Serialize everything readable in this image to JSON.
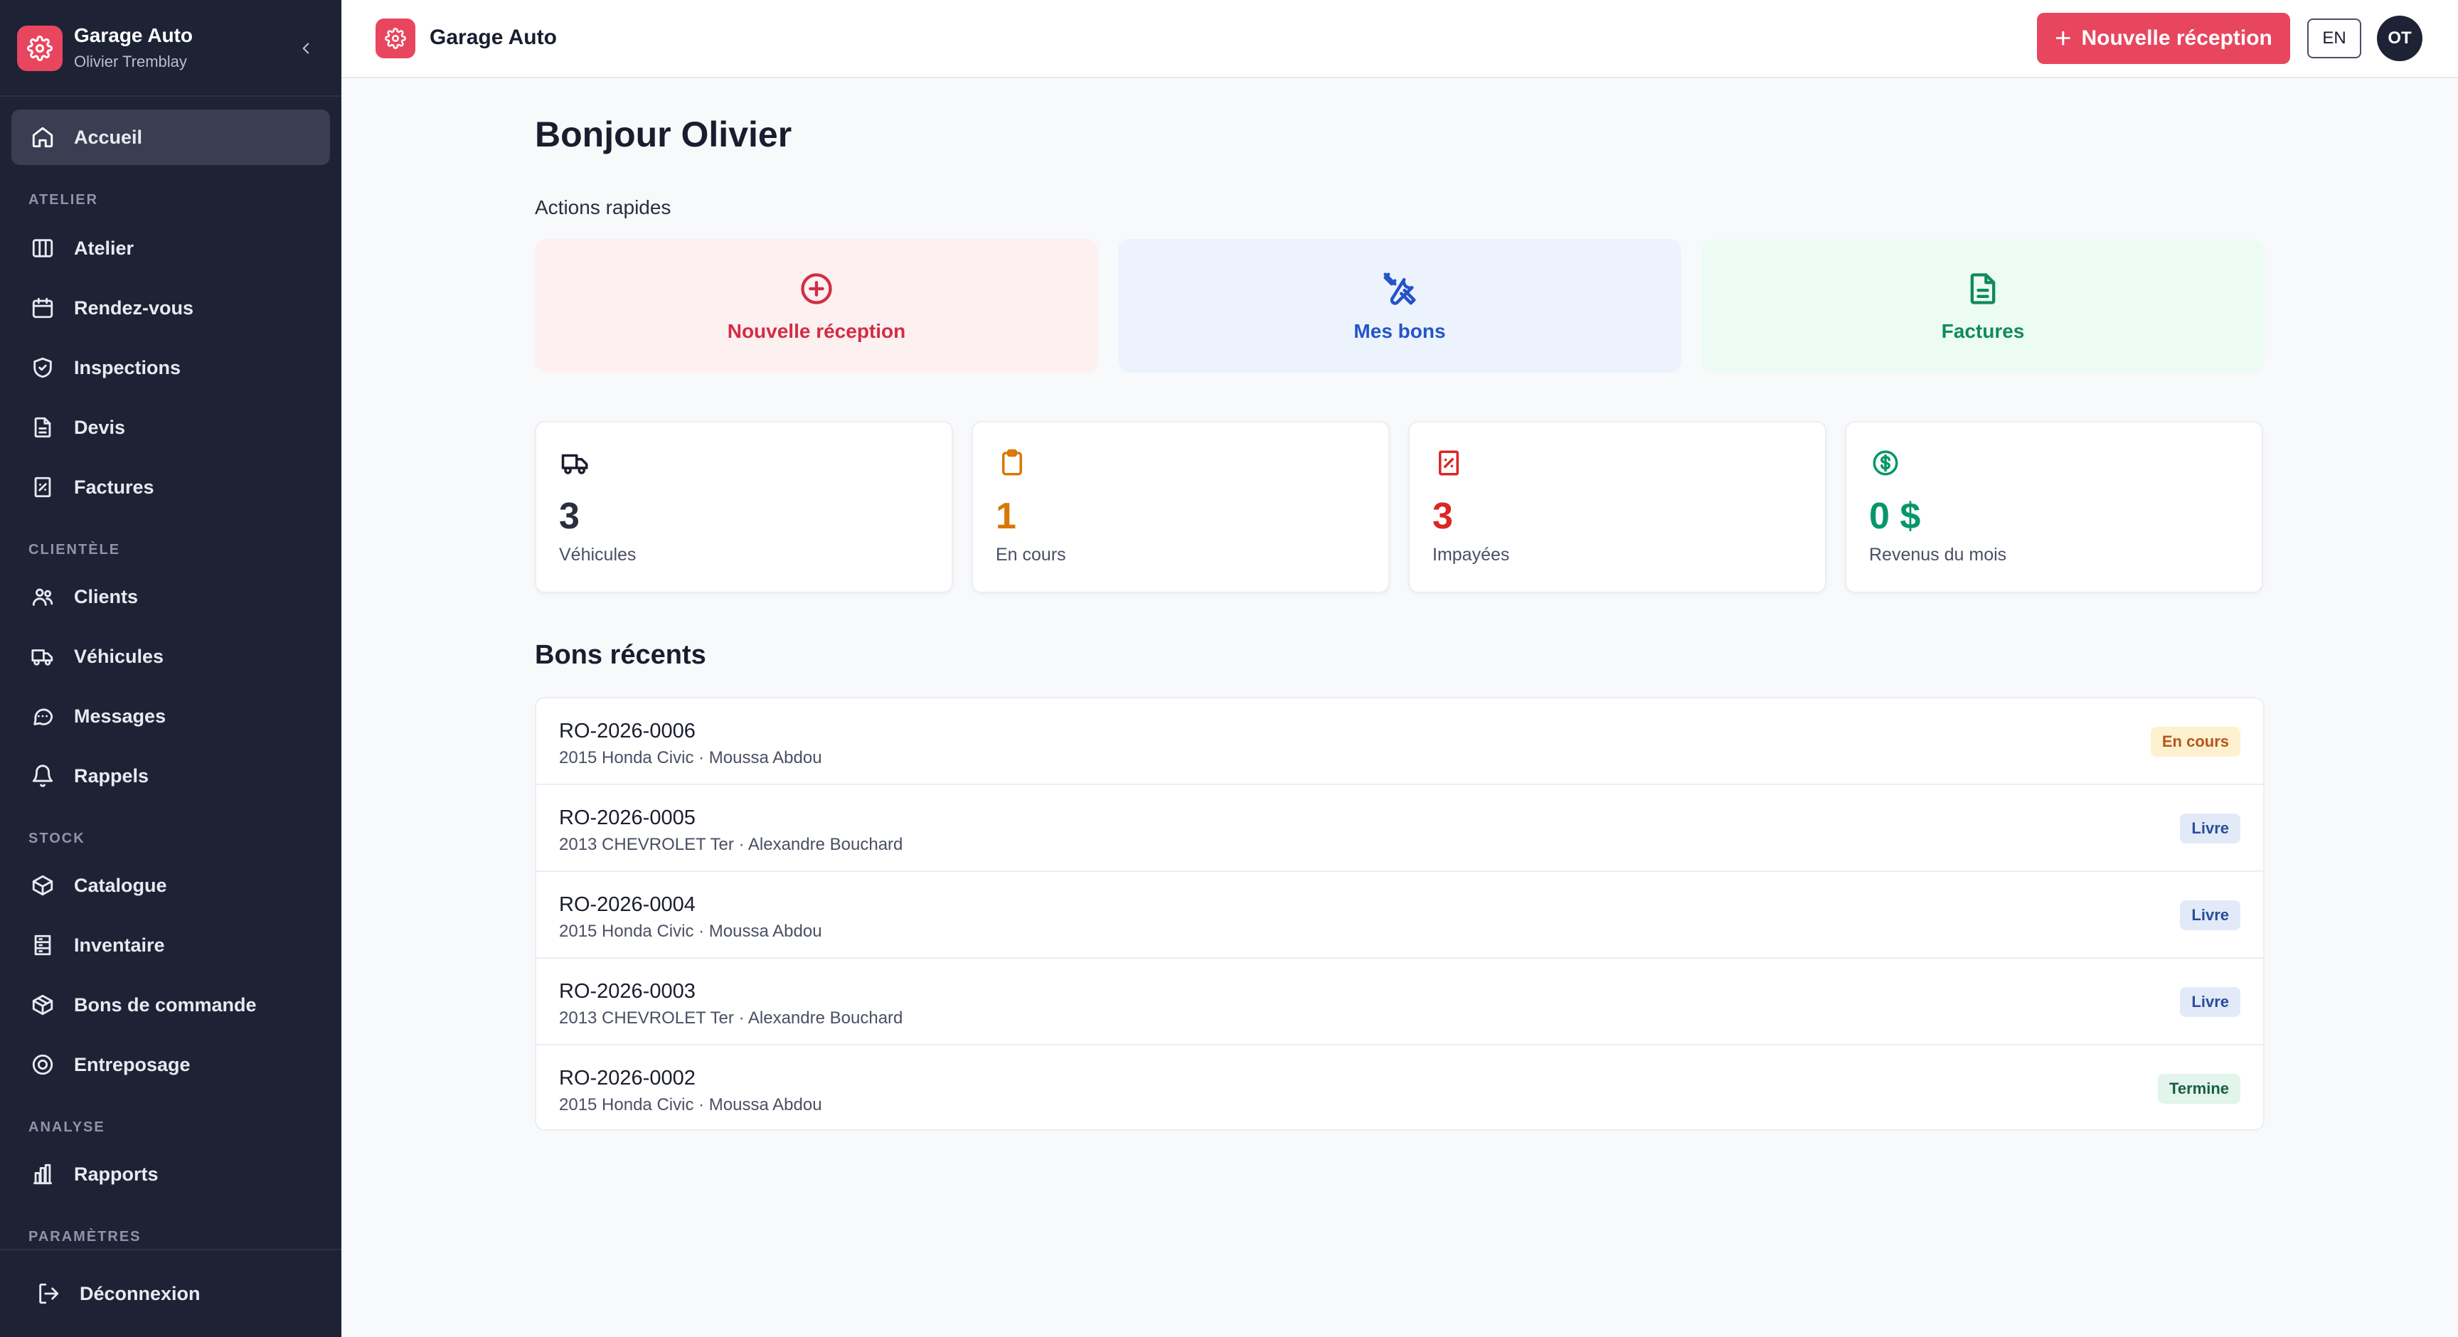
{
  "sidebar": {
    "app_title": "Garage Auto",
    "user_name": "Olivier Tremblay",
    "home_label": "Accueil",
    "sections": {
      "atelier": "ATELIER",
      "clientele": "CLIENTÈLE",
      "stock": "STOCK",
      "analyse": "ANALYSE",
      "parametres": "PARAMÈTRES"
    },
    "items": {
      "atelier": "Atelier",
      "rendezvous": "Rendez-vous",
      "inspections": "Inspections",
      "devis": "Devis",
      "factures": "Factures",
      "clients": "Clients",
      "vehicules": "Véhicules",
      "messages": "Messages",
      "rappels": "Rappels",
      "catalogue": "Catalogue",
      "inventaire": "Inventaire",
      "bons_commande": "Bons de commande",
      "entreposage": "Entreposage",
      "rapports": "Rapports"
    },
    "logout_label": "Déconnexion"
  },
  "topbar": {
    "title": "Garage Auto",
    "new_button_label": "Nouvelle réception",
    "lang_label": "EN",
    "avatar_initials": "OT"
  },
  "main": {
    "greeting": "Bonjour Olivier",
    "quick_actions_label": "Actions rapides",
    "quick_actions": {
      "new_reception": "Nouvelle réception",
      "my_orders": "Mes bons",
      "invoices": "Factures"
    },
    "stats": {
      "vehicles": {
        "value": "3",
        "label": "Véhicules"
      },
      "in_progress": {
        "value": "1",
        "label": "En cours"
      },
      "unpaid": {
        "value": "3",
        "label": "Impayées"
      },
      "revenue": {
        "value": "0 $",
        "label": "Revenus du mois"
      }
    },
    "recent_title": "Bons récents",
    "recent_orders": [
      {
        "number": "RO-2026-0006",
        "description": "2015 Honda Civic · Moussa Abdou",
        "status": "En cours"
      },
      {
        "number": "RO-2026-0005",
        "description": "2013 CHEVROLET Ter · Alexandre Bouchard",
        "status": "Livre"
      },
      {
        "number": "RO-2026-0004",
        "description": "2015 Honda Civic · Moussa Abdou",
        "status": "Livre"
      },
      {
        "number": "RO-2026-0003",
        "description": "2013 CHEVROLET Ter · Alexandre Bouchard",
        "status": "Livre"
      },
      {
        "number": "RO-2026-0002",
        "description": "2015 Honda Civic · Moussa Abdou",
        "status": "Termine"
      }
    ]
  },
  "colors": {
    "accent": "#e8465e",
    "sidebar_bg": "#1e2235",
    "in_progress": "#d97706",
    "unpaid": "#dc2626",
    "revenue": "#059669",
    "blue_action": "#2454c8"
  }
}
